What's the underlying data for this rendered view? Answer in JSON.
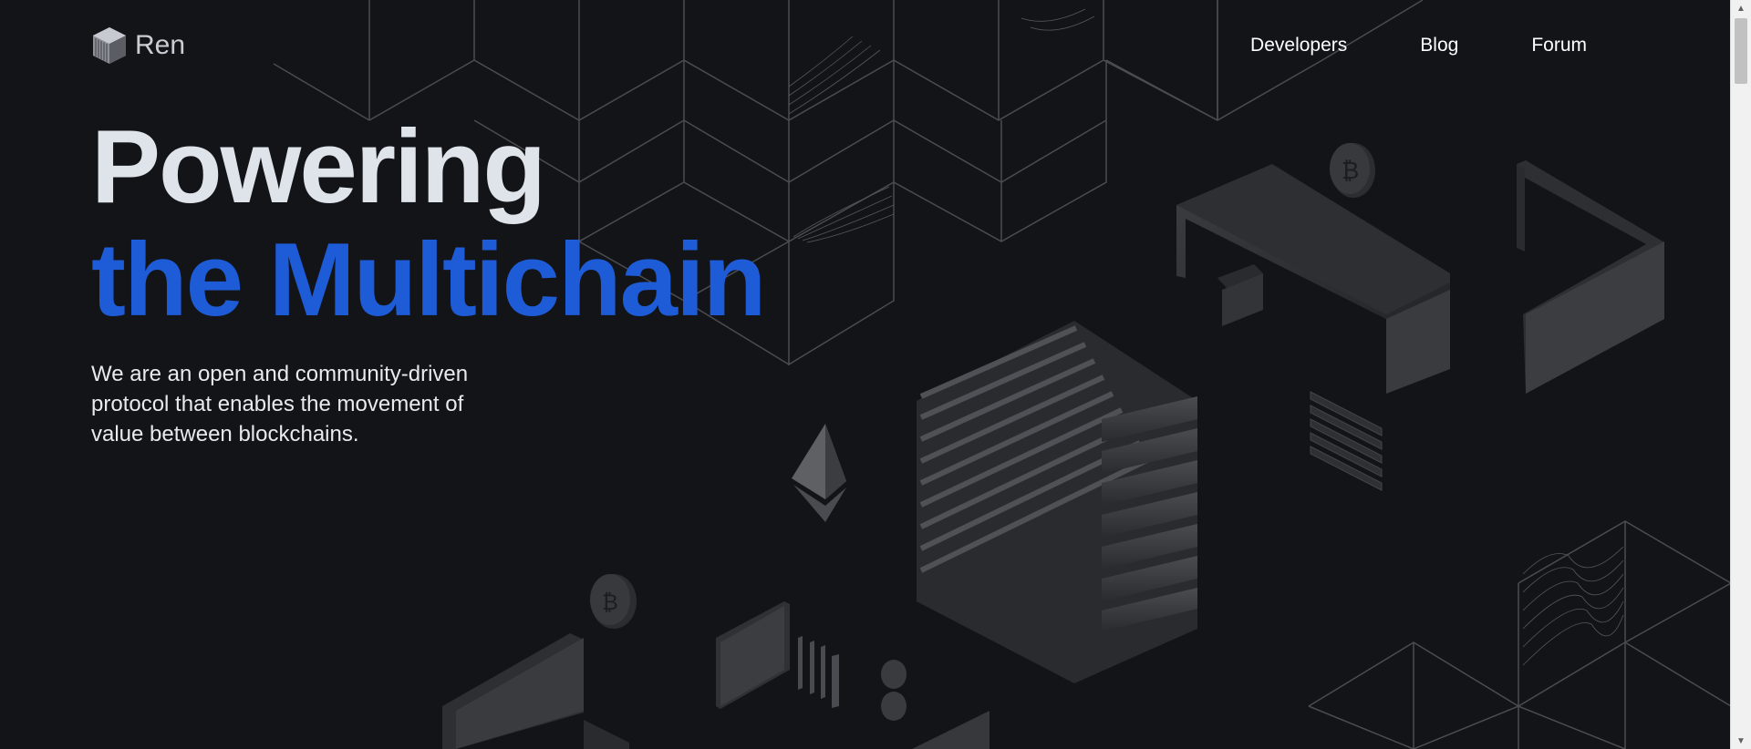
{
  "header": {
    "logo_text": "Ren",
    "logo_icon": "ren-cube-icon",
    "nav": [
      {
        "label": "Developers"
      },
      {
        "label": "Blog"
      },
      {
        "label": "Forum"
      }
    ]
  },
  "hero": {
    "title_line1": "Powering",
    "title_line2": "the Multichain",
    "subtitle": "We are an open and community-driven protocol that enables the movement of value between blockchains."
  },
  "colors": {
    "background": "#131418",
    "title_primary": "#dfe3ea",
    "title_accent": "#1e5bd6",
    "text": "#e8eaee"
  },
  "icons": {
    "ethereum": "ethereum-icon",
    "bitcoin": "bitcoin-coin-icon",
    "coin": "coin-icon"
  }
}
